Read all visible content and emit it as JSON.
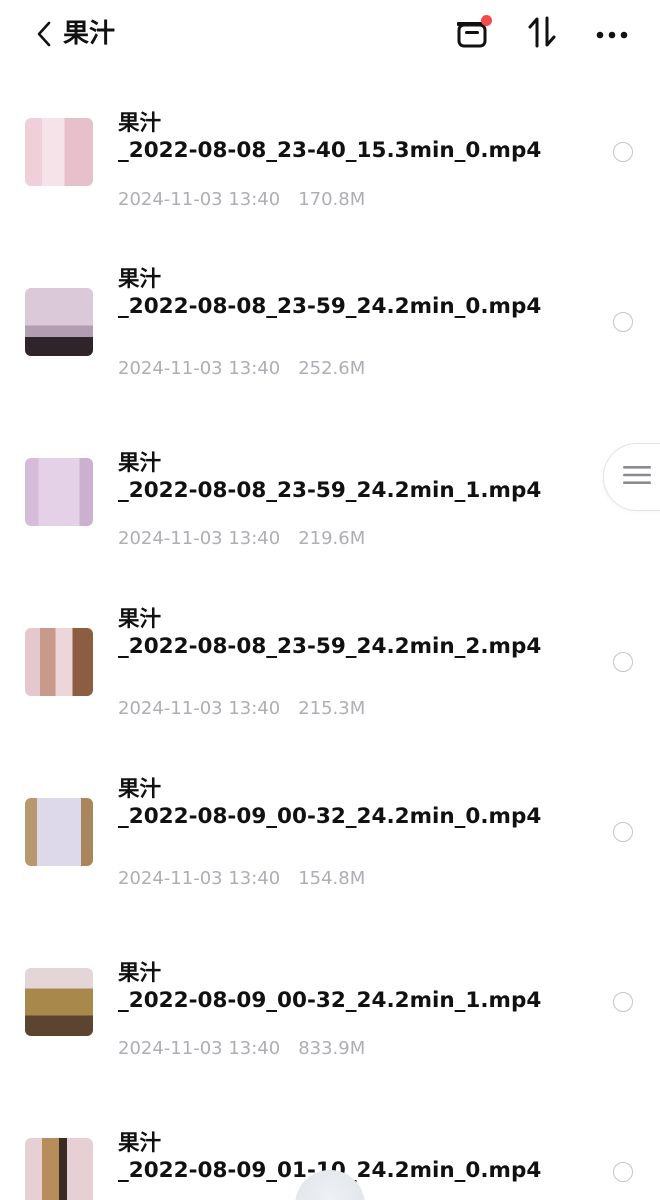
{
  "header": {
    "title": "果汁",
    "back_icon": "chevron-left-icon",
    "actions": [
      {
        "name": "clip-board-icon",
        "has_badge": true,
        "badge_color": "#f24b4b"
      },
      {
        "name": "sort-icon"
      },
      {
        "name": "more-icon"
      }
    ]
  },
  "files": [
    {
      "prefix": "果汁",
      "filename": "_2022-08-08_23-40_15.3min_0.mp4",
      "date": "2024-11-03 13:40",
      "size": "170.8M",
      "thumb_colors": [
        "#f3d6dd",
        "#e9c4cf",
        "#f7e4ea"
      ]
    },
    {
      "prefix": "果汁",
      "filename": "_2022-08-08_23-59_24.2min_0.mp4",
      "date": "2024-11-03 13:40",
      "size": "252.6M",
      "thumb_colors": [
        "#d8c5d6",
        "#b79fb6",
        "#3a2e36"
      ]
    },
    {
      "prefix": "果汁",
      "filename": "_2022-08-08_23-59_24.2min_1.mp4",
      "date": "2024-11-03 13:40",
      "size": "219.6M",
      "thumb_colors": [
        "#e3cfe6",
        "#d2b9d8",
        "#c8a7cc"
      ]
    },
    {
      "prefix": "果汁",
      "filename": "_2022-08-08_23-59_24.2min_2.mp4",
      "date": "2024-11-03 13:40",
      "size": "215.3M",
      "thumb_colors": [
        "#e6c9cf",
        "#c79486",
        "#8a5a3c"
      ]
    },
    {
      "prefix": "果汁",
      "filename": "_2022-08-09_00-32_24.2min_0.mp4",
      "date": "2024-11-03 13:40",
      "size": "154.8M",
      "thumb_colors": [
        "#d9d5e8",
        "#b49a76",
        "#e8e2ef"
      ]
    },
    {
      "prefix": "果汁",
      "filename": "_2022-08-09_00-32_24.2min_1.mp4",
      "date": "2024-11-03 13:40",
      "size": "833.9M",
      "thumb_colors": [
        "#e2d4d6",
        "#a7874a",
        "#5a4430"
      ]
    },
    {
      "prefix": "果汁",
      "filename": "_2022-08-09_01-10_24.2min_0.mp4",
      "date": "",
      "size": "",
      "thumb_colors": [
        "#e4cfd3",
        "#b58c5a",
        "#3a2a22"
      ]
    }
  ],
  "side_tab_icon": "menu-lines-icon"
}
